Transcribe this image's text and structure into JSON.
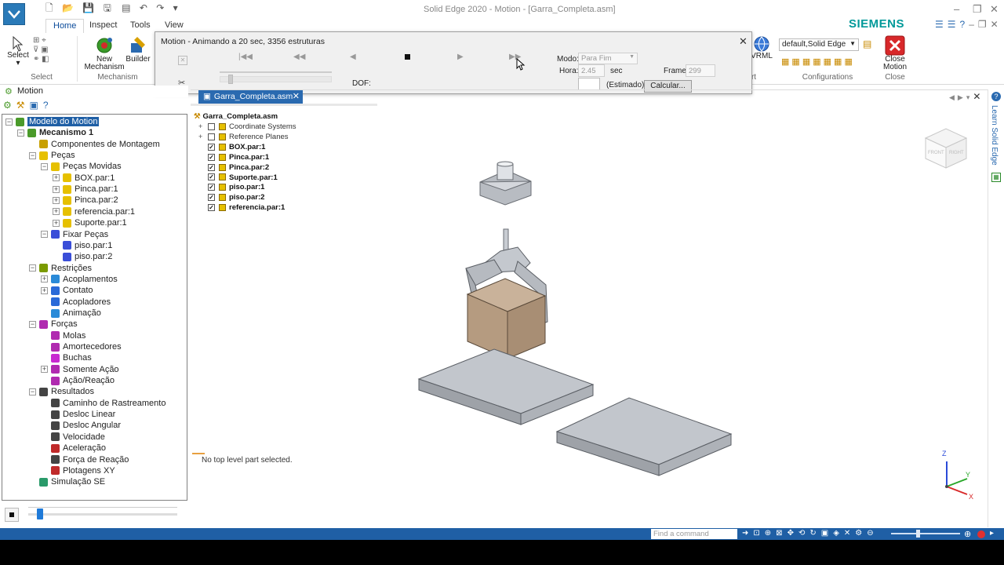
{
  "window": {
    "title": "Solid Edge 2020 - Motion - [Garra_Completa.asm]",
    "brand": "SIEMENS"
  },
  "tabs": [
    "Home",
    "Inspect",
    "Tools",
    "View"
  ],
  "ribbon": {
    "select": {
      "button": "Select",
      "group": "Select"
    },
    "new_mechanism": "New\nMechanism",
    "builder": "Builder",
    "mechanism_group": "Mechanism",
    "vrml": "VRML",
    "configuration_value": "default,Solid Edge",
    "configurations_group": "Configurations",
    "close_motion": "Close\nMotion",
    "close_group": "Close",
    "group_partial": "rt"
  },
  "dialog": {
    "title": "Motion - Animando a 20 sec, 3356 estruturas",
    "mode_label": "Modo:",
    "mode_value": "Para Fim",
    "time_label": "Hora:",
    "time_value": "2.45",
    "time_unit": "sec",
    "frame_label": "Frame:",
    "frame_value": "299",
    "estimated": "(Estimado)",
    "dof_label": "DOF:",
    "calc_button": "Calcular..."
  },
  "left_pane": {
    "header": "Motion",
    "tree": [
      {
        "label": "Modelo do Motion",
        "level": 0,
        "exp": "−",
        "icon": "motion-model-icon",
        "color": "#4a9a2a",
        "selected": true
      },
      {
        "label": "Mecanismo 1",
        "level": 1,
        "exp": "−",
        "icon": "mechanism-icon",
        "color": "#4a9a2a",
        "bold": true
      },
      {
        "label": "Componentes de Montagem",
        "level": 2,
        "exp": "",
        "icon": "assembly-components-icon",
        "color": "#c8a000"
      },
      {
        "label": "Peças",
        "level": 2,
        "exp": "−",
        "icon": "parts-icon",
        "color": "#e6c000"
      },
      {
        "label": "Peças Movidas",
        "level": 3,
        "exp": "−",
        "icon": "moved-parts-icon",
        "color": "#e6c000"
      },
      {
        "label": "BOX.par:1",
        "level": 4,
        "exp": "+",
        "icon": "part-icon",
        "color": "#e6c000"
      },
      {
        "label": "Pinca.par:1",
        "level": 4,
        "exp": "+",
        "icon": "part-icon",
        "color": "#e6c000"
      },
      {
        "label": "Pinca.par:2",
        "level": 4,
        "exp": "+",
        "icon": "part-icon",
        "color": "#e6c000"
      },
      {
        "label": "referencia.par:1",
        "level": 4,
        "exp": "+",
        "icon": "part-icon",
        "color": "#e6c000"
      },
      {
        "label": "Suporte.par:1",
        "level": 4,
        "exp": "+",
        "icon": "part-icon",
        "color": "#e6c000"
      },
      {
        "label": "Fixar Peças",
        "level": 3,
        "exp": "−",
        "icon": "fixed-parts-icon",
        "color": "#3a4ed8"
      },
      {
        "label": "piso.par:1",
        "level": 4,
        "exp": "",
        "icon": "ground-part-icon",
        "color": "#3a4ed8"
      },
      {
        "label": "piso.par:2",
        "level": 4,
        "exp": "",
        "icon": "ground-part-icon",
        "color": "#3a4ed8"
      },
      {
        "label": "Restrições",
        "level": 2,
        "exp": "−",
        "icon": "constraints-icon",
        "color": "#7a9a00"
      },
      {
        "label": "Acoplamentos",
        "level": 3,
        "exp": "+",
        "icon": "joints-icon",
        "color": "#2a8ad8"
      },
      {
        "label": "Contato",
        "level": 3,
        "exp": "+",
        "icon": "contact-icon",
        "color": "#2a6ad8"
      },
      {
        "label": "Acopladores",
        "level": 3,
        "exp": "",
        "icon": "couplers-icon",
        "color": "#2a6ad8"
      },
      {
        "label": "Animação",
        "level": 3,
        "exp": "",
        "icon": "animation-icon",
        "color": "#2a8ad8"
      },
      {
        "label": "Forças",
        "level": 2,
        "exp": "−",
        "icon": "forces-icon",
        "color": "#b02ab0"
      },
      {
        "label": "Molas",
        "level": 3,
        "exp": "",
        "icon": "springs-icon",
        "color": "#b02ab0"
      },
      {
        "label": "Amortecedores",
        "level": 3,
        "exp": "",
        "icon": "dampers-icon",
        "color": "#b02ab0"
      },
      {
        "label": "Buchas",
        "level": 3,
        "exp": "",
        "icon": "bushings-icon",
        "color": "#c82ad0"
      },
      {
        "label": "Somente Ação",
        "level": 3,
        "exp": "+",
        "icon": "action-only-icon",
        "color": "#b02ab0"
      },
      {
        "label": "Ação/Reação",
        "level": 3,
        "exp": "",
        "icon": "action-reaction-icon",
        "color": "#b02ab0"
      },
      {
        "label": "Resultados",
        "level": 2,
        "exp": "−",
        "icon": "results-icon",
        "color": "#444"
      },
      {
        "label": "Caminho de Rastreamento",
        "level": 3,
        "exp": "",
        "icon": "trace-path-icon",
        "color": "#444"
      },
      {
        "label": "Desloc Linear",
        "level": 3,
        "exp": "",
        "icon": "linear-displacement-icon",
        "color": "#444"
      },
      {
        "label": "Desloc Angular",
        "level": 3,
        "exp": "",
        "icon": "angular-displacement-icon",
        "color": "#444"
      },
      {
        "label": "Velocidade",
        "level": 3,
        "exp": "",
        "icon": "velocity-icon",
        "color": "#444"
      },
      {
        "label": "Aceleração",
        "level": 3,
        "exp": "",
        "icon": "acceleration-icon",
        "color": "#c02a2a"
      },
      {
        "label": "Força de Reação",
        "level": 3,
        "exp": "",
        "icon": "reaction-force-icon",
        "color": "#444"
      },
      {
        "label": "Plotagens XY",
        "level": 3,
        "exp": "",
        "icon": "xy-plots-icon",
        "color": "#c02a2a"
      },
      {
        "label": "Simulação SE",
        "level": 2,
        "exp": "",
        "icon": "se-simulation-icon",
        "color": "#2a9a6a"
      }
    ],
    "slider_fraction": 0.08
  },
  "document_tab": "Garra_Completa.asm",
  "pathfinder": {
    "root": "Garra_Completa.asm",
    "items": [
      {
        "label": "Coordinate Systems",
        "checked": false,
        "bold": false,
        "exp": "+"
      },
      {
        "label": "Reference Planes",
        "checked": false,
        "bold": false,
        "exp": "+"
      },
      {
        "label": "BOX.par:1",
        "checked": true,
        "bold": true,
        "exp": ""
      },
      {
        "label": "Pinca.par:1",
        "checked": true,
        "bold": true,
        "exp": ""
      },
      {
        "label": "Pinca.par:2",
        "checked": true,
        "bold": true,
        "exp": ""
      },
      {
        "label": "Suporte.par:1",
        "checked": true,
        "bold": true,
        "exp": ""
      },
      {
        "label": "piso.par:1",
        "checked": true,
        "bold": true,
        "exp": ""
      },
      {
        "label": "piso.par:2",
        "checked": true,
        "bold": true,
        "exp": ""
      },
      {
        "label": "referencia.par:1",
        "checked": true,
        "bold": true,
        "exp": ""
      }
    ],
    "status_message": "No top level part selected."
  },
  "viewcube": {
    "front": "FRONT",
    "right": "RIGHT"
  },
  "triad": {
    "z": "Z",
    "y": "Y",
    "x": "X"
  },
  "right_panel_label": "Learn Solid Edge",
  "statusbar": {
    "find_placeholder": "Find a command"
  }
}
